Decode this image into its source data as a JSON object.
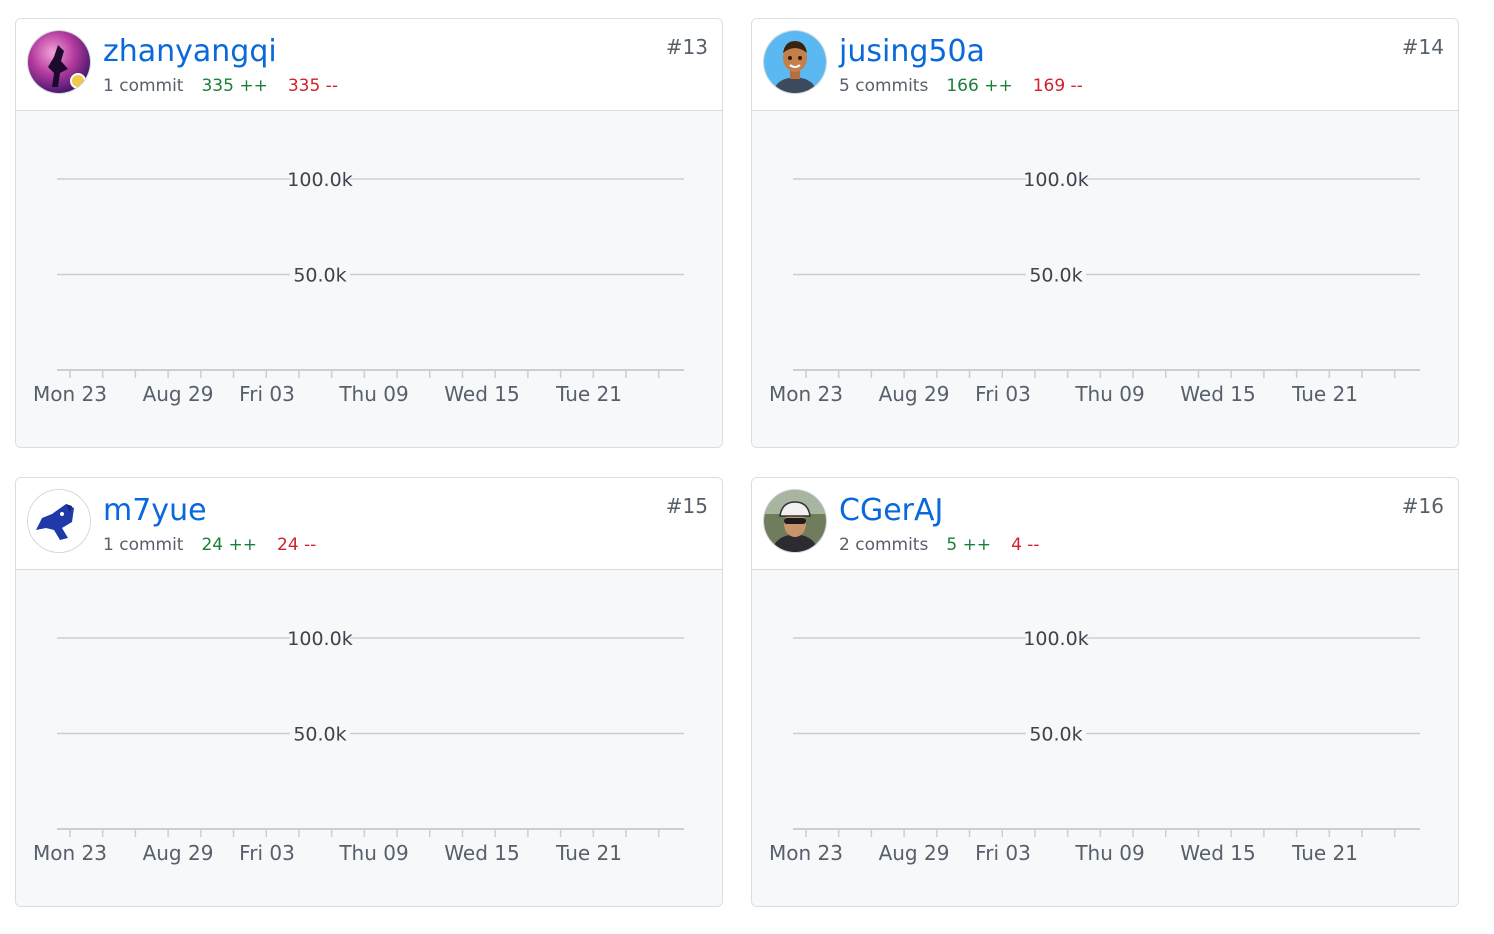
{
  "contributors": [
    {
      "rank": "#13",
      "username": "zhanyangqi",
      "commits": "1 commit",
      "additions": "335 ++",
      "deletions": "335 --"
    },
    {
      "rank": "#14",
      "username": "jusing50a",
      "commits": "5 commits",
      "additions": "166 ++",
      "deletions": "169 --"
    },
    {
      "rank": "#15",
      "username": "m7yue",
      "commits": "1 commit",
      "additions": "24 ++",
      "deletions": "24 --"
    },
    {
      "rank": "#16",
      "username": "CGerAJ",
      "commits": "2 commits",
      "additions": "5 ++",
      "deletions": "4 --"
    }
  ],
  "chart_data": [
    {
      "type": "area",
      "y_ticks": [
        "100.0k",
        "50.0k"
      ],
      "x_ticks": [
        "Mon 23",
        "Aug 29",
        "Fri 03",
        "Thu 09",
        "Wed 15",
        "Tue 21"
      ],
      "ylim": [
        0,
        100000
      ],
      "grid": true
    },
    {
      "type": "area",
      "y_ticks": [
        "100.0k",
        "50.0k"
      ],
      "x_ticks": [
        "Mon 23",
        "Aug 29",
        "Fri 03",
        "Thu 09",
        "Wed 15",
        "Tue 21"
      ],
      "ylim": [
        0,
        100000
      ],
      "grid": true
    },
    {
      "type": "area",
      "y_ticks": [
        "100.0k",
        "50.0k"
      ],
      "x_ticks": [
        "Mon 23",
        "Aug 29",
        "Fri 03",
        "Thu 09",
        "Wed 15",
        "Tue 21"
      ],
      "ylim": [
        0,
        100000
      ],
      "grid": true
    },
    {
      "type": "area",
      "y_ticks": [
        "100.0k",
        "50.0k"
      ],
      "x_ticks": [
        "Mon 23",
        "Aug 29",
        "Fri 03",
        "Thu 09",
        "Wed 15",
        "Tue 21"
      ],
      "ylim": [
        0,
        100000
      ],
      "grid": true
    }
  ],
  "colors": {
    "link": "#0969da",
    "additions": "#1a7f37",
    "deletions": "#cf222e",
    "grid": "#c8cfd6"
  }
}
